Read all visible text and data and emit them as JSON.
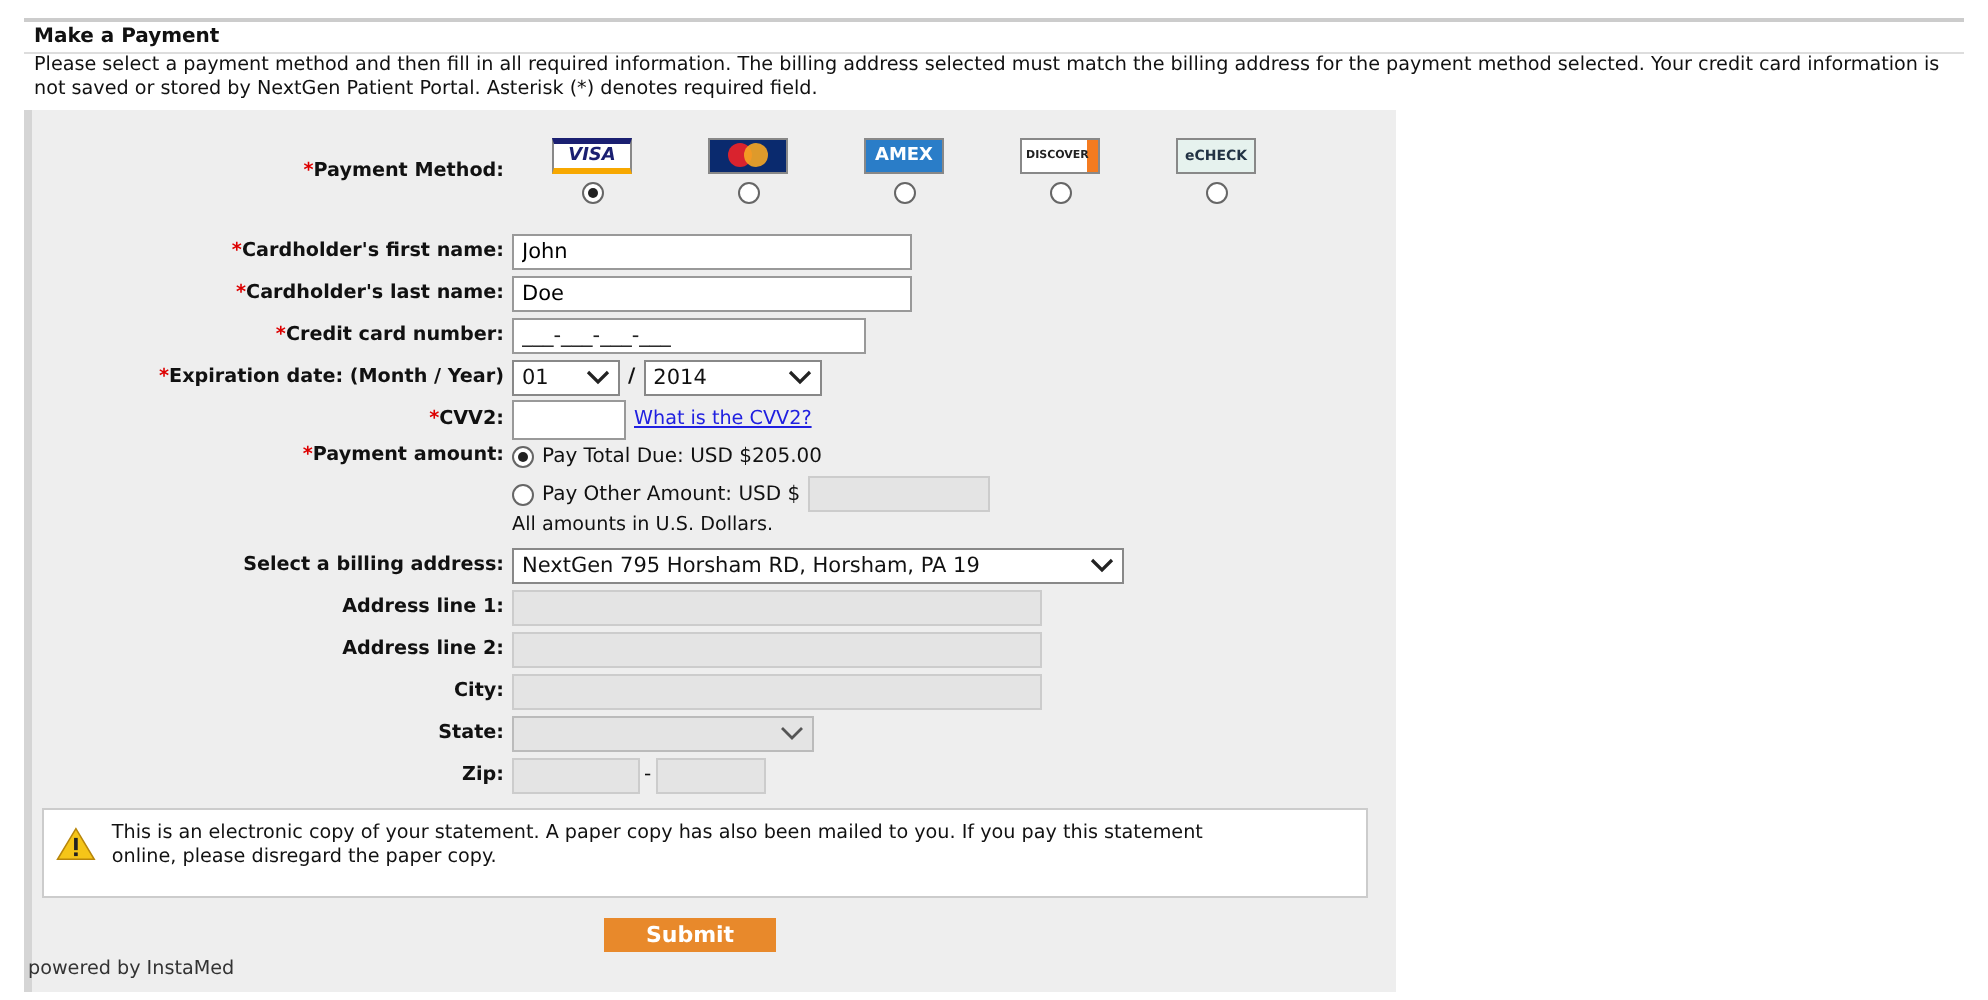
{
  "section": {
    "title": "Make a Payment",
    "instructions": "Please select a payment method and then fill in all required information. The billing address selected must match the billing address for the payment method selected. Your credit card information is not saved or stored by NextGen Patient Portal. Asterisk (*) denotes required field."
  },
  "rows": [
    {
      "kind": "methods",
      "required_mark": "*",
      "label": "Payment Method:",
      "options": [
        {
          "kind": "visa",
          "text": "VISA",
          "selected": true
        },
        {
          "kind": "mastercard",
          "selected": false
        },
        {
          "kind": "amex",
          "text": "AMEX",
          "selected": false
        },
        {
          "kind": "discover",
          "text": "DISCOVER",
          "selected": false
        },
        {
          "kind": "echeck",
          "text": "eCHECK",
          "selected": false
        }
      ]
    },
    {
      "kind": "text",
      "required_mark": "*",
      "label": "Cardholder's first name:",
      "value": "John"
    },
    {
      "kind": "text",
      "required_mark": "*",
      "label": "Cardholder's last name:",
      "value": "Doe"
    },
    {
      "kind": "card",
      "required_mark": "*",
      "label": "Credit card number:",
      "placeholder": "___-___-___-___"
    },
    {
      "kind": "expiry",
      "required_mark": "*",
      "label": "Expiration date: (Month / Year)",
      "month": "01",
      "separator": "/",
      "year": "2014"
    },
    {
      "kind": "cvv",
      "required_mark": "*",
      "label": "CVV2:",
      "link": "What is the CVV2?"
    },
    {
      "kind": "amount",
      "required_mark": "*",
      "label": "Payment amount:",
      "options": [
        {
          "text": "Pay Total Due: USD $205.00",
          "selected": true,
          "has_input": false
        },
        {
          "text": "Pay Other Amount: USD $",
          "selected": false,
          "has_input": true
        }
      ],
      "note": "All amounts in U.S. Dollars."
    },
    {
      "kind": "select",
      "label": "Select a billing address:",
      "value": "NextGen 795 Horsham RD, Horsham, PA 19"
    },
    {
      "kind": "input",
      "label": "Address line 1:",
      "disabled": true
    },
    {
      "kind": "input",
      "label": "Address line 2:",
      "disabled": true
    },
    {
      "kind": "input",
      "label": "City:",
      "disabled": true
    },
    {
      "kind": "state",
      "label": "State:",
      "disabled": true
    },
    {
      "kind": "zip",
      "label": "Zip:",
      "separator": "-",
      "disabled": true
    }
  ],
  "notice": "This is an electronic copy of your statement. A paper copy has also been mailed  to you. If you pay this statement online, please disregard the paper copy.",
  "submit": "Submit",
  "powered_by": "powered by InstaMed"
}
